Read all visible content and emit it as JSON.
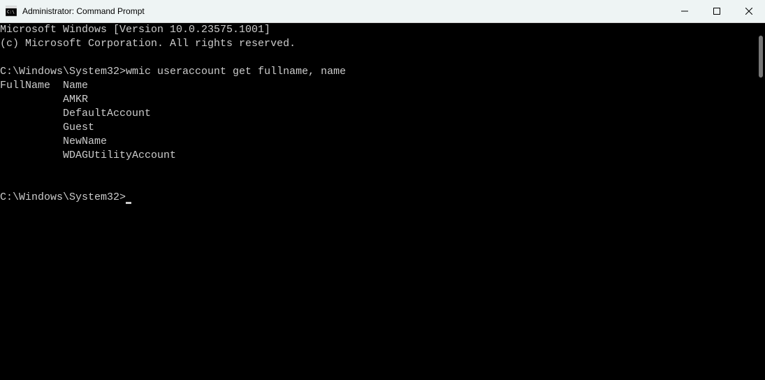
{
  "titlebar": {
    "title": "Administrator: Command Prompt"
  },
  "terminal": {
    "banner_line1": "Microsoft Windows [Version 10.0.23575.1001]",
    "banner_line2": "(c) Microsoft Corporation. All rights reserved.",
    "prompt1_path": "C:\\Windows\\System32>",
    "command1": "wmic useraccount get fullname, name",
    "output_header": "FullName  Name",
    "output_rows": [
      "          AMKR",
      "          DefaultAccount",
      "          Guest",
      "          NewName",
      "          WDAGUtilityAccount"
    ],
    "prompt2_path": "C:\\Windows\\System32>"
  }
}
